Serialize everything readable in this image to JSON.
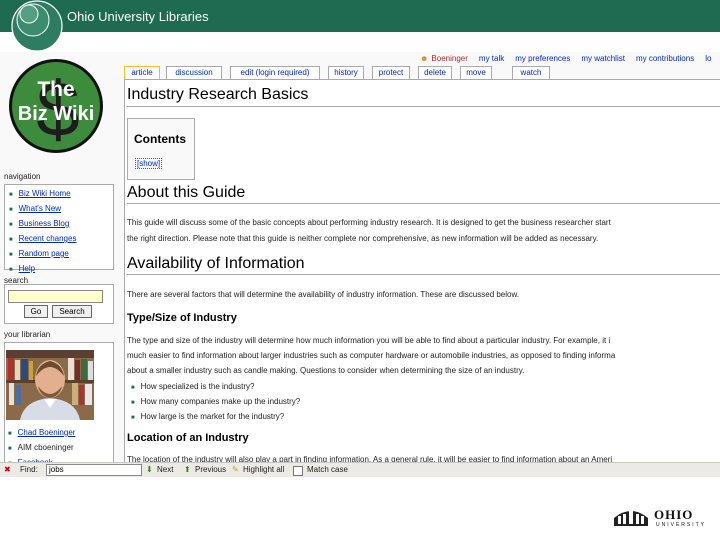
{
  "header": {
    "title": "Ohio University Libraries"
  },
  "sidebar": {
    "logo_line1": "The",
    "logo_line2": "Biz Wiki",
    "logo_symbol": "$",
    "navigation": {
      "heading": "navigation",
      "items": [
        "Biz Wiki Home",
        "What's New",
        "Business Blog",
        "Recent changes",
        "Random page",
        "Help"
      ]
    },
    "search": {
      "heading": "search",
      "go_label": "Go",
      "search_label": "Search"
    },
    "librarian": {
      "heading": "your librarian",
      "links": [
        "Chad Boeninger",
        "AIM cboeninger",
        "Facebook"
      ]
    }
  },
  "userbar": {
    "items": [
      "Boeninger",
      "my talk",
      "my preferences",
      "my watchlist",
      "my contributions",
      "lo"
    ]
  },
  "tabs": [
    "article",
    "discussion",
    "edit (login required)",
    "history",
    "protect",
    "delete",
    "move",
    "watch"
  ],
  "page": {
    "title": "Industry Research Basics",
    "toc": {
      "title": "Contents",
      "toggle": "[show]"
    },
    "sections": {
      "about": {
        "heading": "About this Guide",
        "lines": [
          "This guide will discuss some of the basic concepts about performing industry research. It is designed to get the business researcher start",
          "the right direction. Please note that this guide is neither complete nor comprehensive, as new information will be added as necessary."
        ]
      },
      "availability": {
        "heading": "Availability of Information",
        "line": "There are several factors that will determine the availability of industry information. These are discussed below."
      },
      "type_size": {
        "heading": "Type/Size of Industry",
        "lines": [
          "The type and size of the industry will determine how much information you will be able to find about a particular industry. For example, it i",
          "much easier to find information about larger industries such as computer hardware or automobile industries, as opposed to finding informa",
          "about a smaller industry such as candle making. Questions to consider when determining the size of an industry."
        ],
        "bullets": [
          "How specialized is the industry?",
          "How many companies make up the industry?",
          "How large is the market for the industry?"
        ]
      },
      "location": {
        "heading": "Location of an Industry",
        "line": "The location of the industry will also play a part in finding information. As a general rule, it will be easier to find information about an Ameri"
      }
    }
  },
  "findbar": {
    "find_label": "Find:",
    "find_value": "jobs",
    "next_label": "Next",
    "previous_label": "Previous",
    "highlight_label": "Highlight all",
    "match_case_label": "Match case"
  },
  "footer_logo": {
    "word": "OHIO",
    "sub": "UNIVERSITY"
  },
  "colors": {
    "header_green": "#1f6b52",
    "link_blue": "#002bb8",
    "tab_selected": "#fabd23"
  }
}
